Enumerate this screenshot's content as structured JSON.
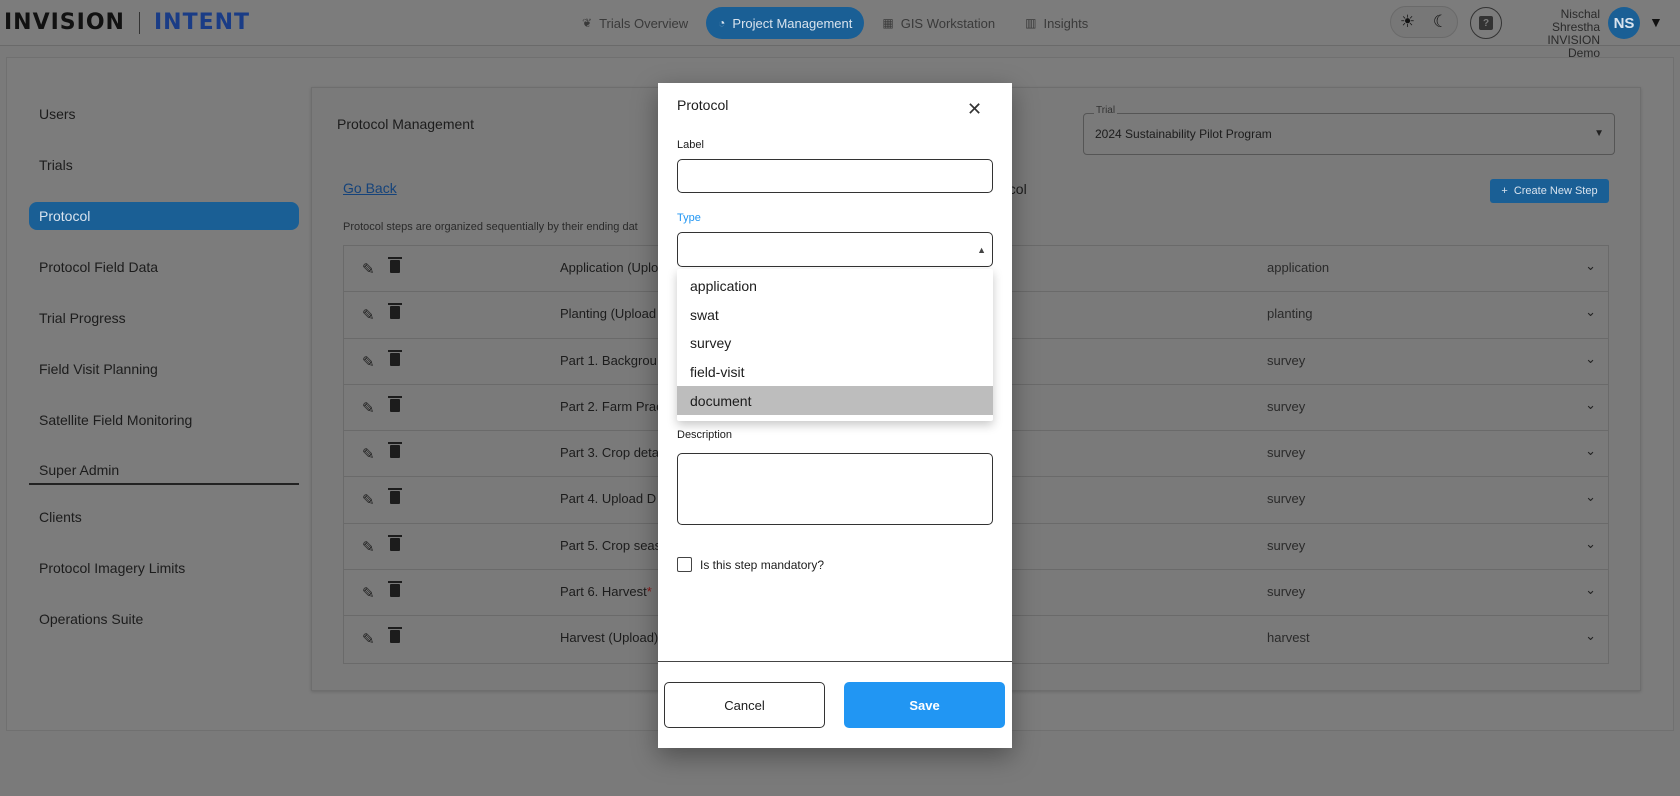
{
  "header": {
    "logo_left": "INVISION",
    "logo_right": "INTENT",
    "nav": [
      {
        "label": "Trials Overview",
        "icon": "leaf-icon"
      },
      {
        "label": "Project Management",
        "icon": "pie-chart-icon"
      },
      {
        "label": "GIS Workstation",
        "icon": "grid-icon"
      },
      {
        "label": "Insights",
        "icon": "bar-chart-icon"
      }
    ],
    "active_nav": "Project Management",
    "user_name": "Nischal Shrestha",
    "org_name": "INVISION Demo",
    "avatar_initials": "NS"
  },
  "sidebar": {
    "items": [
      {
        "label": "Users"
      },
      {
        "label": "Trials"
      },
      {
        "label": "Protocol"
      },
      {
        "label": "Protocol Field Data"
      },
      {
        "label": "Trial Progress"
      },
      {
        "label": "Field Visit Planning"
      },
      {
        "label": "Satellite Field Monitoring"
      }
    ],
    "active_item": "Protocol",
    "section_label": "Super Admin",
    "admin_items": [
      {
        "label": "Clients"
      },
      {
        "label": "Protocol Imagery Limits"
      },
      {
        "label": "Operations Suite"
      }
    ]
  },
  "main": {
    "title": "Protocol Management",
    "trial_legend": "Trial",
    "trial_value": "2024 Sustainability Pilot Program",
    "go_back": "Go Back",
    "protocol_name_fragment": "ocol",
    "create_button": "Create New Step",
    "note": "Protocol steps are organized sequentially by their ending dat",
    "steps": [
      {
        "label": "Application (Uplo",
        "mandatory": false,
        "type": "application"
      },
      {
        "label": "Planting (Upload",
        "mandatory": false,
        "type": "planting"
      },
      {
        "label": "Part 1. Backgrou",
        "mandatory": false,
        "type": "survey"
      },
      {
        "label": "Part 2. Farm Prac",
        "mandatory": false,
        "type": "survey"
      },
      {
        "label": "Part 3. Crop deta",
        "mandatory": false,
        "type": "survey"
      },
      {
        "label": "Part 4. Upload D",
        "mandatory": false,
        "type": "survey"
      },
      {
        "label": "Part 5. Crop seas",
        "mandatory": false,
        "type": "survey"
      },
      {
        "label": "Part 6. Harvest",
        "mandatory": true,
        "type": "survey"
      },
      {
        "label": "Harvest (Upload)",
        "mandatory": false,
        "type": "harvest"
      }
    ]
  },
  "modal": {
    "title": "Protocol",
    "label_field": {
      "label": "Label",
      "value": ""
    },
    "type_field": {
      "label": "Type",
      "value": ""
    },
    "type_options": [
      "application",
      "swat",
      "survey",
      "field-visit",
      "document"
    ],
    "highlighted_option": "document",
    "description_field": {
      "label": "Description",
      "value": ""
    },
    "mandatory_checkbox": {
      "label": "Is this step mandatory?",
      "checked": false
    },
    "cancel_label": "Cancel",
    "save_label": "Save"
  },
  "colors": {
    "brand_blue": "#2196f3",
    "overlay_dim_blue": "#1a5f95",
    "selected_option_bg": "#bdbdbd"
  }
}
